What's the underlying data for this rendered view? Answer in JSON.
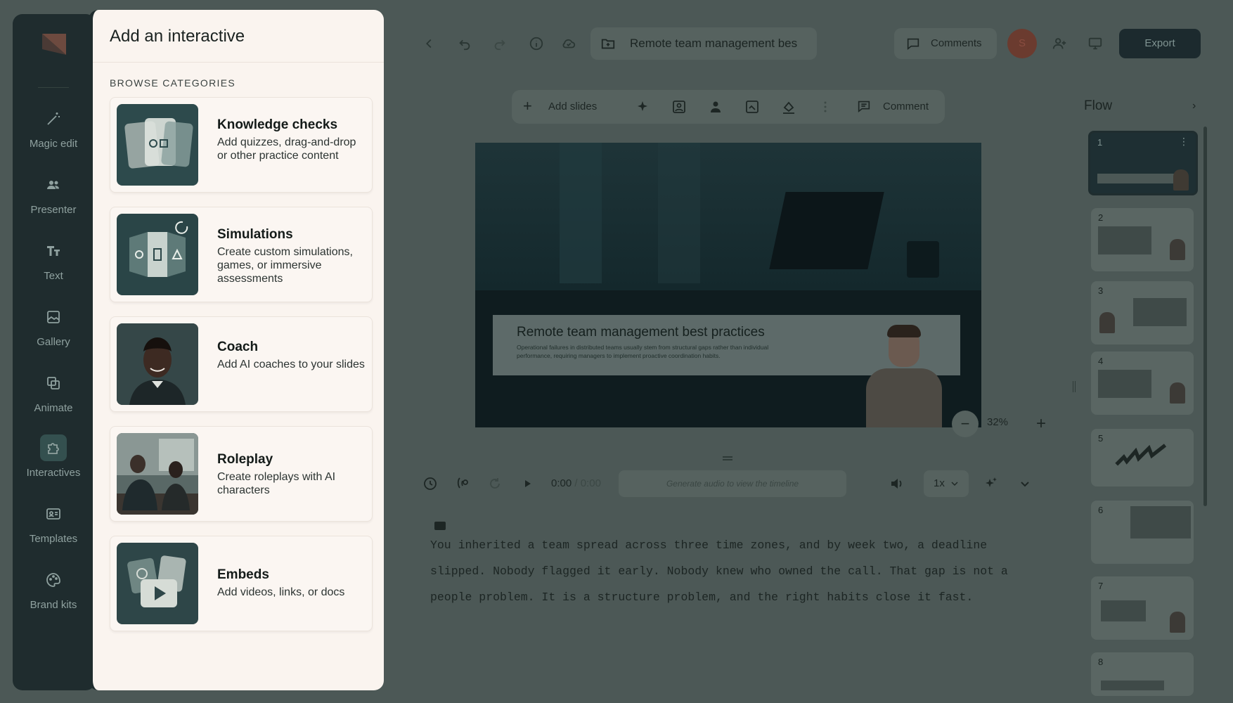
{
  "sidebar": {
    "items": [
      {
        "label": "Magic edit",
        "icon": "magic-wand-icon"
      },
      {
        "label": "Presenter",
        "icon": "people-icon"
      },
      {
        "label": "Text",
        "icon": "text-icon"
      },
      {
        "label": "Gallery",
        "icon": "image-icon"
      },
      {
        "label": "Animate",
        "icon": "layers-icon"
      },
      {
        "label": "Interactives",
        "icon": "puzzle-icon"
      },
      {
        "label": "Templates",
        "icon": "template-icon"
      },
      {
        "label": "Brand kits",
        "icon": "palette-icon"
      }
    ]
  },
  "modal": {
    "title": "Add an interactive",
    "section_label": "BROWSE CATEGORIES",
    "cards": [
      {
        "title": "Knowledge checks",
        "desc": "Add quizzes, drag-and-drop or other practice content"
      },
      {
        "title": "Simulations",
        "desc": "Create custom simulations, games, or immersive assessments"
      },
      {
        "title": "Coach",
        "desc": "Add AI coaches to your slides"
      },
      {
        "title": "Roleplay",
        "desc": "Create roleplays with AI characters"
      },
      {
        "title": "Embeds",
        "desc": "Add videos, links, or docs"
      }
    ]
  },
  "header": {
    "doc_title": "Remote team management bes",
    "comments_label": "Comments",
    "avatar_initial": "S",
    "export_label": "Export"
  },
  "toolbar": {
    "add_slides_label": "Add slides",
    "comment_label": "Comment"
  },
  "slide": {
    "title": "Remote team management best practices",
    "body": "Operational failures in distributed teams usually stem from structural gaps rather than individual performance, requiring managers to implement proactive coordination habits."
  },
  "zoom": {
    "value": "32%",
    "minus": "−",
    "plus": "+"
  },
  "audio": {
    "time_current": "0:00",
    "time_sep": " / ",
    "time_total": "0:00",
    "hint": "Generate audio to view the timeline",
    "speed": "1x"
  },
  "script_text": "You inherited a team spread across three time zones, and by week two, a deadline slipped. Nobody flagged it early. Nobody knew who owned the call. That gap is not a people problem. It is a structure problem, and the right habits close it fast.",
  "flow": {
    "title": "Flow",
    "thumbnails": [
      {
        "num": "1"
      },
      {
        "num": "2"
      },
      {
        "num": "3"
      },
      {
        "num": "4"
      },
      {
        "num": "5"
      },
      {
        "num": "6"
      },
      {
        "num": "7"
      },
      {
        "num": "8"
      }
    ]
  },
  "colors": {
    "sidebar_bg": "#1f2c2e",
    "modal_bg": "#faf4ef",
    "overlay": "#4c5856",
    "export_bg": "#1c2a2e"
  }
}
